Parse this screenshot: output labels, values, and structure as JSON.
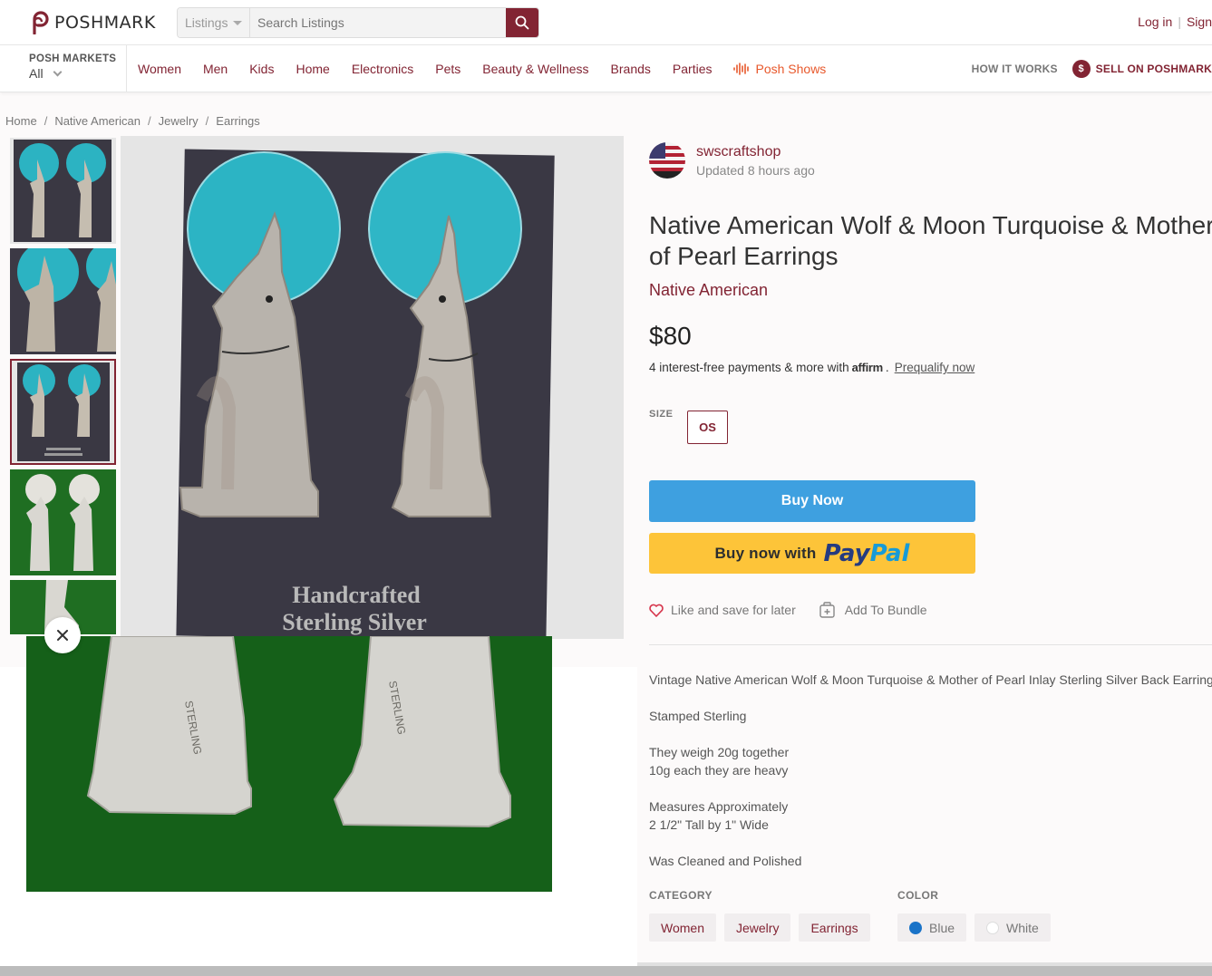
{
  "header": {
    "brand_name": "POSHMARK",
    "search_scope": "Listings",
    "search_placeholder": "Search Listings",
    "login": "Log in",
    "signup": "Sign"
  },
  "markets": {
    "title": "POSH MARKETS",
    "value": "All"
  },
  "nav": {
    "links": [
      "Women",
      "Men",
      "Kids",
      "Home",
      "Electronics",
      "Pets",
      "Beauty & Wellness",
      "Brands",
      "Parties"
    ],
    "posh_shows": "Posh Shows",
    "how_it_works": "HOW IT WORKS",
    "sell": "SELL ON POSHMARK",
    "sell_badge": "$"
  },
  "breadcrumb": [
    "Home",
    "Native American",
    "Jewelry",
    "Earrings"
  ],
  "gallery": {
    "card_line1": "Handcrafted",
    "card_line2": "Sterling Silver",
    "stamp": "STERLING"
  },
  "listing": {
    "seller": "swscraftshop",
    "updated": "Updated 8 hours ago",
    "title_line1": "Native American Wolf & Moon Turquoise & Mother",
    "title_line2": "of Pearl Earrings",
    "brand": "Native American",
    "price": "$80",
    "affirm_text": "4 interest-free payments & more with",
    "affirm_logo": "affirm",
    "affirm_period": ".",
    "prequalify": "Prequalify now",
    "size_label": "SIZE",
    "size": "OS",
    "buy_now": "Buy Now",
    "paypal_lead": "Buy now with",
    "paypal_pay": "Pay",
    "paypal_pal": "Pal",
    "like": "Like and save for later",
    "bundle": "Add To Bundle"
  },
  "description": [
    "Vintage Native American Wolf & Moon Turquoise & Mother of Pearl Inlay Sterling Silver Back Earrings",
    "Stamped Sterling",
    "They weigh 20g together",
    "10g each they are heavy",
    "Measures Approximately",
    "2 1/2\" Tall by 1\" Wide",
    "Was Cleaned and Polished"
  ],
  "category": {
    "label": "CATEGORY",
    "items": [
      "Women",
      "Jewelry",
      "Earrings"
    ]
  },
  "color": {
    "label": "COLOR",
    "items": [
      {
        "name": "Blue",
        "swatch": "#1a73c8"
      },
      {
        "name": "White",
        "swatch": "#ffffff"
      }
    ]
  },
  "colors": {
    "accent": "#822433",
    "buy_now": "#3ea0e0",
    "paypal": "#fdc439",
    "posh_shows": "#e8582b"
  },
  "icons": [
    "poshmark-logo-icon",
    "caret-down-icon",
    "search-icon",
    "chevron-down-icon",
    "live-waveform-icon",
    "dollar-icon",
    "close-icon",
    "heart-icon",
    "bundle-icon"
  ]
}
